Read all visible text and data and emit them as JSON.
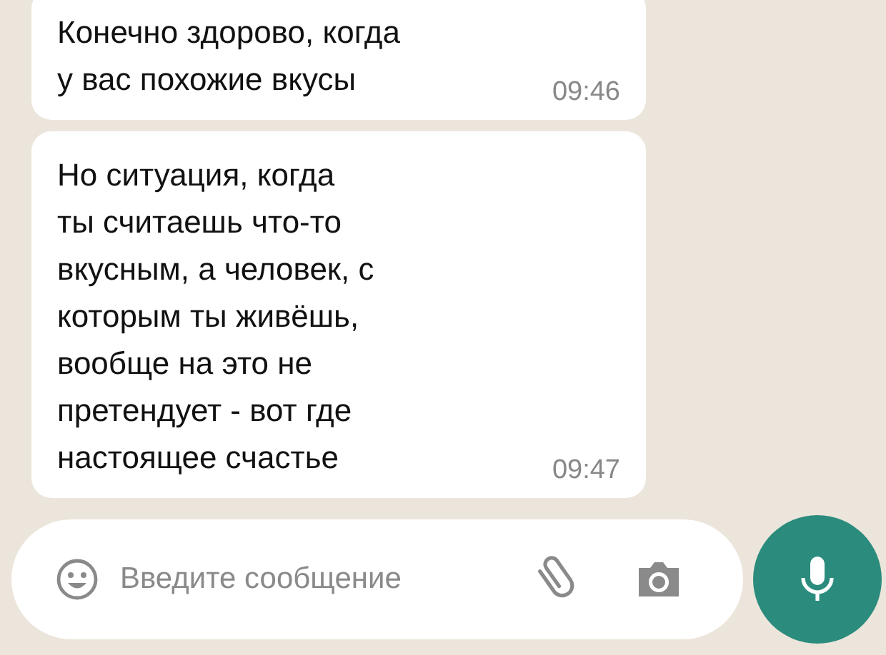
{
  "messages": [
    {
      "text": "Конечно здорово, когда\nу вас похожие вкусы",
      "time": "09:46"
    },
    {
      "text": "Но ситуация, когда\nты считаешь что-то\nвкусным, а человек, с\nкоторым ты живёшь,\nвообще на это не\nпретендует - вот где\nнастоящее счастье",
      "time": "09:47"
    }
  ],
  "composer": {
    "placeholder": "Введите сообщение"
  }
}
